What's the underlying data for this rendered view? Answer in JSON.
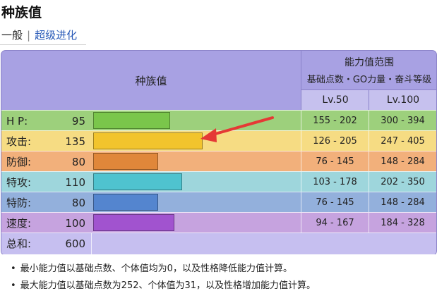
{
  "header": {
    "title": "种族值"
  },
  "tabs": {
    "active": "一般",
    "separator": "|",
    "link": "超级进化"
  },
  "table": {
    "header_left": "种族值",
    "header_right_title": "能力值范围",
    "header_right_sub": "基础点数・GO力量・奋斗等级",
    "lv50": "Lv.50",
    "lv100": "Lv.100",
    "stats": [
      {
        "label": "H P:",
        "value": "95",
        "base": 95,
        "lv50": "155 - 202",
        "lv100": "300 - 394",
        "row_color": "#9dd07c",
        "bar_color": "#7ac64b"
      },
      {
        "label": "攻击:",
        "value": "135",
        "base": 135,
        "lv50": "126 - 205",
        "lv100": "247 - 405",
        "row_color": "#f6dc83",
        "bar_color": "#f2c42d"
      },
      {
        "label": "防御:",
        "value": "80",
        "base": 80,
        "lv50": "76 - 145",
        "lv100": "148 - 284",
        "row_color": "#f2b07b",
        "bar_color": "#e0873a"
      },
      {
        "label": "特攻:",
        "value": "110",
        "base": 110,
        "lv50": "103 - 178",
        "lv100": "202 - 350",
        "row_color": "#9ed6dc",
        "bar_color": "#4fc3cf"
      },
      {
        "label": "特防:",
        "value": "80",
        "base": 80,
        "lv50": "76 - 145",
        "lv100": "148 - 284",
        "row_color": "#93b0dc",
        "bar_color": "#5485cf"
      },
      {
        "label": "速度:",
        "value": "100",
        "base": 100,
        "lv50": "94 - 167",
        "lv100": "184 - 328",
        "row_color": "#c6a3df",
        "bar_color": "#a153cf"
      }
    ],
    "total": {
      "label": "总和:",
      "value": "600",
      "row_color": "#c6bff0"
    }
  },
  "notes": [
    "最小能力值以基础点数、个体值均为0，以及性格降低能力值计算。",
    "最大能力值以基础点数为252、个体值为31，以及性格增加能力值计算。"
  ],
  "colors": {
    "table_border": "#8b83c9",
    "table_header_bg": "#a8a1e3",
    "link": "#2a5bb8",
    "arrow": "#e53935"
  }
}
